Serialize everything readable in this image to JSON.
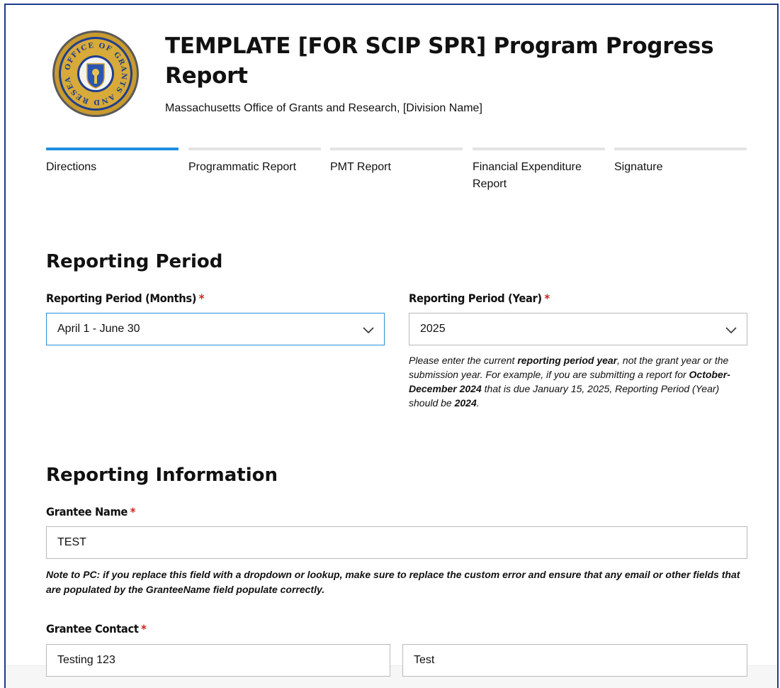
{
  "header": {
    "title": "TEMPLATE [FOR SCIP SPR] Program Progress Report",
    "subtitle": "Massachusetts Office of Grants and Research, [Division Name]",
    "seal_text": "OFFICE OF GRANTS AND RESEARCH"
  },
  "tabs": [
    {
      "label": "Directions",
      "active": true
    },
    {
      "label": "Programmatic Report",
      "active": false
    },
    {
      "label": "PMT Report",
      "active": false
    },
    {
      "label": "Financial Expenditure Report",
      "active": false
    },
    {
      "label": "Signature",
      "active": false
    }
  ],
  "reporting_period": {
    "heading": "Reporting Period",
    "months_label": "Reporting Period (Months)",
    "months_value": "April 1 - June 30",
    "year_label": "Reporting Period (Year)",
    "year_value": "2025",
    "help": {
      "p1": "Please enter the current ",
      "b1": "reporting period year",
      "p2": ", not the grant year or the submission year. For example, if you are submitting a report for ",
      "b2": "October-December 2024",
      "p3": " that is due January 15, 2025, Reporting Period (Year) should be ",
      "b3": "2024",
      "p4": "."
    }
  },
  "reporting_information": {
    "heading": "Reporting Information",
    "grantee_name_label": "Grantee Name",
    "grantee_name_value": "TEST",
    "note": "Note to PC: if you replace this field with a dropdown or lookup, make sure to replace the custom error and ensure that any email or other fields that are populated by the GranteeName field populate correctly.",
    "grantee_contact_label": "Grantee Contact",
    "contact_first_value": "Testing 123",
    "contact_last_value": "Test"
  },
  "required_marker": "*",
  "colors": {
    "accent": "#1f8ee0",
    "required": "#d01f1f",
    "border": "#1e3a8a",
    "seal_gold": "#c99a2e",
    "seal_blue": "#1f3f8c"
  }
}
